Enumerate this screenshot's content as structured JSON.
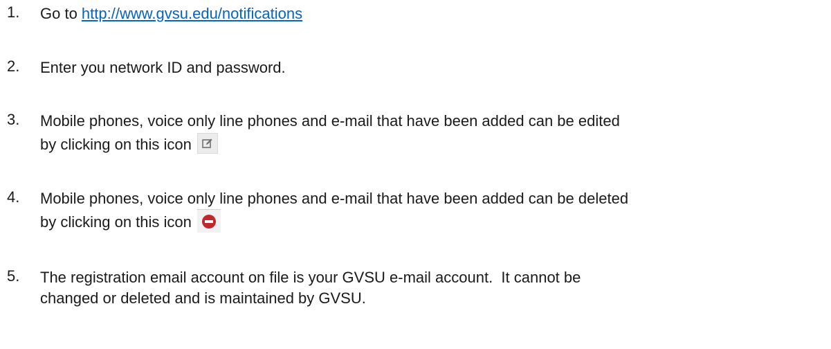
{
  "steps": [
    {
      "number": "1.",
      "text_before": "Go to ",
      "link_text": "http://www.gvsu.edu/notifications"
    },
    {
      "number": "2.",
      "text": "Enter you network ID and password."
    },
    {
      "number": "3.",
      "line1": "Mobile phones, voice only line phones and e-mail that have been added can be edited",
      "line2": "by clicking on this icon",
      "icon": "edit-icon"
    },
    {
      "number": "4.",
      "line1": "Mobile phones, voice only line phones and e-mail that have been added can be deleted",
      "line2": "by clicking on this icon",
      "icon": "delete-icon"
    },
    {
      "number": "5.",
      "line1": "The registration email account on file is your GVSU e-mail account.  It cannot be",
      "line2": "changed or deleted and is maintained by GVSU."
    }
  ],
  "colors": {
    "link": "#0563c1",
    "delete_icon": "#c0282d",
    "edit_icon": "#707070"
  }
}
